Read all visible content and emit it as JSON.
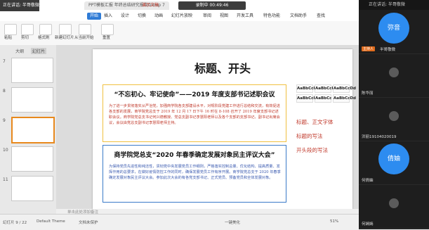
{
  "topbar": {
    "speaking": "正在讲话: 半哥敬微;",
    "tab_doc1": "PPT模板汇报 年终总结研究报告Group 7",
    "tab_doc2": "演示文稿",
    "recording": "录制中 00:49:46"
  },
  "menu": {
    "items": [
      "开始",
      "插入",
      "设计",
      "切换",
      "动画",
      "幻灯片放映",
      "审阅",
      "视图",
      "开发工具",
      "特色功能",
      "文档助手",
      "查找"
    ],
    "active_index": 0
  },
  "toolbar": {
    "paste": "粘贴",
    "cut": "剪切",
    "format_painter": "格式刷",
    "new_slide": "新建幻灯片",
    "from_template": "从当前开始",
    "reset": "重置"
  },
  "slide_panel": {
    "tab_outline": "大纲",
    "tab_slides": "幻灯片",
    "numbers": [
      "7",
      "8",
      "9",
      "10",
      "11"
    ],
    "selected_index": 2
  },
  "slide": {
    "title": "标题、开头",
    "box1": {
      "heading": "“不忘初心、牢记使命”——2019 年度支部书记述职会议",
      "body": "为了进一步贯彻落实从严治党，加强商学院各支部建设水平，对规阶段党建工作进行总结和交流，有效促进各支部的发展，商学院党总支于 2019 年 12 月 17 日下午 16 时在 8-108 召开了 2019 年度支部书记述职会议。商学院党总支书记何兴德教授、党总支副书记李慧阳老师以及各个支部的支部书记、副书记出席会议，会议由党总支副书记李慧阳老师主持。"
    },
    "box2": {
      "heading": "商学院党总支“2020 年春季确定发展对象民主评议大会”",
      "body": "为保持党员先进性和纯洁性，贯彻党中央发展党员工作细则，严格落实控制总量、优化结构、提高质量、发挥作用的总要求，在做好疫情防控工作的同时，确保发展党员工作有序开展。商学院党总支于 2020 年春季确定发展对象民主评议大会。参加此次大会的有各党支部书记、正式党员、预备党员和全体发展对象。"
    },
    "style_samples": [
      "AaBbCcDd",
      "AaBbCcDd",
      "AaBbCcDd",
      "AaBbCcDd",
      "AaBbCc",
      "AaBbCcDd"
    ],
    "bullets": [
      "标题、正文字体",
      "标题的写法",
      "开头段的写法"
    ]
  },
  "notes": "单击此处添加备注",
  "status": {
    "slide_count": "幻灯片 9 / 22",
    "theme": "Default Theme",
    "doc_status": "文档未保护",
    "beautify": "一键美化",
    "zoom": "51%"
  },
  "people": {
    "header": "正在讲话: 半哥敬微",
    "host_tag": "主持人",
    "tiles": [
      {
        "name": "弥音",
        "label": "半哥敬微",
        "host": true
      },
      {
        "name": "",
        "label": "陈华丽",
        "host": false
      },
      {
        "name": "",
        "label": "洪丽19104020019",
        "host": false
      },
      {
        "name": "倩妯",
        "label": "何倩妯",
        "host": false
      },
      {
        "name": "",
        "label": "何嫣嫣",
        "host": false
      }
    ]
  },
  "colors": {
    "accent": "#2f7bd6",
    "highlight_red": "#c0392b",
    "avatar_blue": "#2d8cf0"
  }
}
